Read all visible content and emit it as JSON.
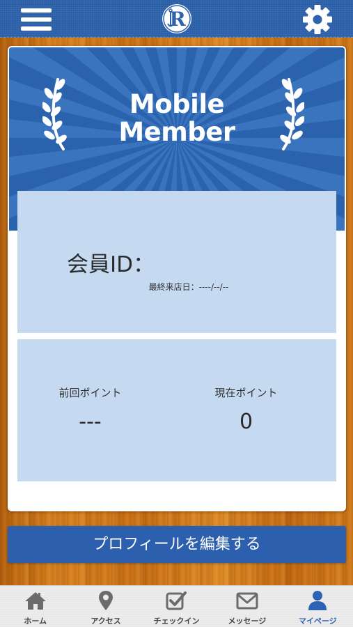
{
  "colors": {
    "header_blue": "#2e63ac",
    "banner_blue": "#2a62ad",
    "panel_light_blue": "#c5d9f1",
    "button_blue": "#2c5fad",
    "tab_active": "#2c63b4",
    "tab_inactive": "#666666",
    "wood": "#d07a1a"
  },
  "header": {
    "menu_icon": "hamburger-menu-icon",
    "logo_icon": "r-anchor-logo",
    "settings_icon": "gear-icon"
  },
  "card": {
    "title_line1": "Mobile",
    "title_line2": "Member",
    "laurel_icon": "laurel-icon",
    "member_id_label": "会員ID：",
    "member_id_value": "----",
    "last_visit": "最終来店日：----/--/--",
    "prev_points_label": "前回ポイント",
    "prev_points_value": "---",
    "current_points_label": "現在ポイント",
    "current_points_value": "0"
  },
  "edit_profile_label": "プロフィールを編集する",
  "tabs": [
    {
      "label": "ホーム",
      "icon": "home-icon",
      "active": false
    },
    {
      "label": "アクセス",
      "icon": "map-pin-icon",
      "active": false
    },
    {
      "label": "チェックイン",
      "icon": "checkbox-icon",
      "active": false
    },
    {
      "label": "メッセージ",
      "icon": "envelope-icon",
      "active": false
    },
    {
      "label": "マイページ",
      "icon": "user-icon",
      "active": true
    }
  ]
}
